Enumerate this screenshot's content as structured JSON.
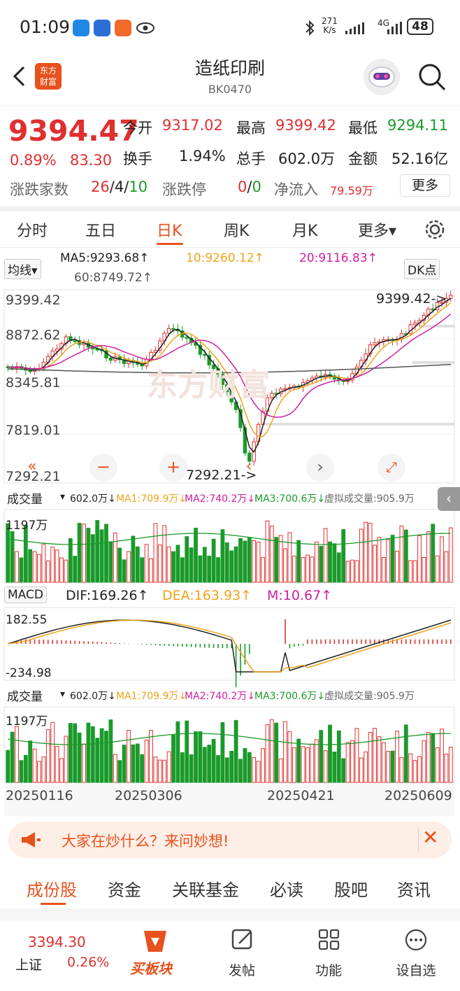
{
  "status_bar": {
    "time": "01:09",
    "net_speed_top": "271",
    "net_speed_bottom": "K/s",
    "network": "4G",
    "battery": "48"
  },
  "header": {
    "title": "造纸印刷",
    "code": "BK0470",
    "logo_line1": "东方",
    "logo_line2": "财富"
  },
  "quote": {
    "price": "9394.47",
    "change_pct": "0.89%",
    "change": "83.30",
    "open_label": "今开",
    "open": "9317.02",
    "high_label": "最高",
    "high": "9399.42",
    "low_label": "最低",
    "low": "9294.11",
    "turnover_label": "换手",
    "turnover": "1.94%",
    "volume_label": "总手",
    "volume": "602.0万",
    "amount_label": "金额",
    "amount": "52.16亿",
    "updown_label": "涨跌家数",
    "up": "26",
    "flat": "4",
    "down": "10",
    "limit_label": "涨跌停",
    "limit_up": "0",
    "limit_down": "0",
    "netflow_label": "净流入",
    "netflow": "79.59万",
    "more_label": "更多",
    "colors": {
      "up": "#e02f2f",
      "down": "#1a9a2a",
      "accent": "#e8501c"
    }
  },
  "chart_tabs": [
    {
      "label": "分时"
    },
    {
      "label": "五日"
    },
    {
      "label": "日K"
    },
    {
      "label": "周K"
    },
    {
      "label": "月K"
    },
    {
      "label": "更多▾"
    }
  ],
  "active_chart_tab": "日K",
  "chart": {
    "ma_selector": "均线▾",
    "ma5": "MA5:9293.68↑",
    "ma10": "10:9260.12↑",
    "ma20": "20:9116.83↑",
    "ma60": "60:8749.72↑",
    "dk_label": "DK点",
    "ticks": [
      "9399.42",
      "8872.62",
      "8345.81",
      "7819.01",
      "7292.21"
    ],
    "high_marker": "9399.42->",
    "low_marker": "7292.21->",
    "volume_title": "成交量",
    "vol": "602.0万↓",
    "vma1": "MA1:709.9万↓",
    "vma2": "MA2:740.2万↓",
    "vma3": "MA3:700.6万↓",
    "virtual_vol": "虚拟成交量:905.9万",
    "vol_tick": "1197万",
    "macd_title": "MACD",
    "dif": "DIF:169.26↑",
    "dea": "DEA:163.93↑",
    "m": "M:10.67↑",
    "macd_top": "182.55",
    "macd_bottom": "-234.98",
    "dates": [
      "20250116",
      "20250306",
      "20250421",
      "20250609"
    ],
    "watermark": "东方财富"
  },
  "ai_bar": {
    "text": "大家在炒什么？来问妙想!"
  },
  "bottom_tabs": [
    {
      "label": "成份股"
    },
    {
      "label": "资金"
    },
    {
      "label": "关联基金"
    },
    {
      "label": "必读"
    },
    {
      "label": "股吧"
    },
    {
      "label": "资讯"
    }
  ],
  "nav": {
    "index_value": "3394.30",
    "index_name": "上证",
    "index_change": "0.26%",
    "buy_label": "买板块",
    "post_label": "发帖",
    "func_label": "功能",
    "watch_label": "设自选"
  }
}
